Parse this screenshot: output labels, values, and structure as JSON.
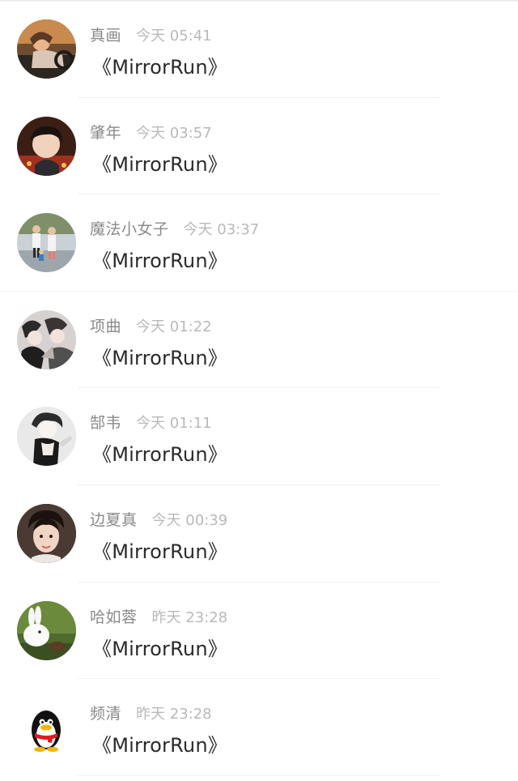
{
  "messages": [
    {
      "name": "真画",
      "time": "今天 05:41",
      "text": "《MirrorRun》",
      "avatar": "photo-driving-avatar"
    },
    {
      "name": "肇年",
      "time": "今天 03:57",
      "text": "《MirrorRun》",
      "avatar": "photo-portrait-avatar"
    },
    {
      "name": "魔法小女子",
      "time": "今天 03:37",
      "text": "《MirrorRun》",
      "avatar": "photo-family-avatar"
    },
    {
      "name": "项曲",
      "time": "今天 01:22",
      "text": "《MirrorRun》",
      "avatar": "photo-anime-group-avatar"
    },
    {
      "name": "郜韦",
      "time": "今天 01:11",
      "text": "《MirrorRun》",
      "avatar": "anime-character-avatar"
    },
    {
      "name": "边夏真",
      "time": "今天 00:39",
      "text": "《MirrorRun》",
      "avatar": "photo-portrait-avatar"
    },
    {
      "name": "哈如蓉",
      "time": "昨天 23:28",
      "text": "《MirrorRun》",
      "avatar": "rabbit-avatar"
    },
    {
      "name": "频清",
      "time": "昨天 23:28",
      "text": "《MirrorRun》",
      "avatar": "qq-penguin-avatar"
    }
  ]
}
